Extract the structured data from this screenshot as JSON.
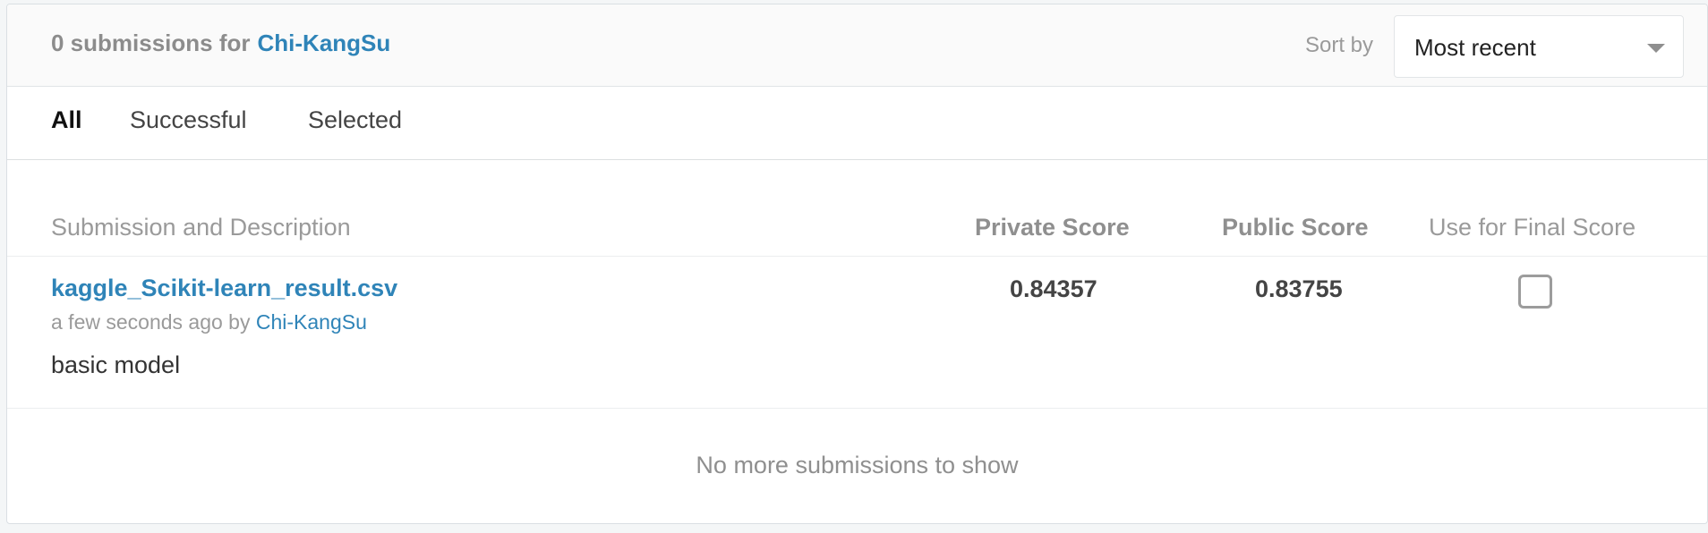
{
  "header": {
    "count_text": "0 submissions for",
    "username": "Chi-KangSu",
    "sort_label": "Sort by",
    "sort_value": "Most recent"
  },
  "tabs": [
    {
      "label": "All",
      "active": true
    },
    {
      "label": "Successful",
      "active": false
    },
    {
      "label": "Selected",
      "active": false
    }
  ],
  "table": {
    "columns": {
      "description": "Submission and Description",
      "private": "Private Score",
      "public": "Public Score",
      "final": "Use for Final Score"
    },
    "rows": [
      {
        "filename": "kaggle_Scikit-learn_result.csv",
        "time_text": "a few seconds ago by",
        "user": "Chi-KangSu",
        "description": "basic model",
        "private_score": "0.84357",
        "public_score": "0.83755",
        "use_for_final": false
      }
    ]
  },
  "footer": {
    "message": "No more submissions to show"
  },
  "colors": {
    "link": "#2f84b8",
    "muted": "#9a9a9a"
  }
}
